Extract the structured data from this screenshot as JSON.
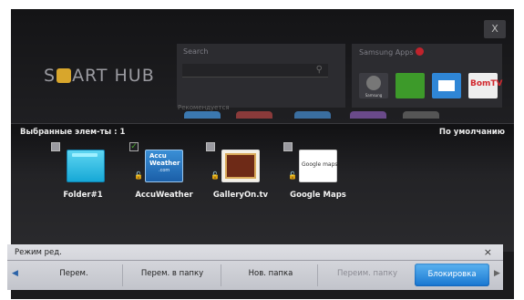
{
  "hub": {
    "logo_prefix": "S",
    "logo_suffix": "ART HUB",
    "close_label": "X",
    "search_title": "Search",
    "recommended_label": "Рекомендуется",
    "apps_title": "Samsung Apps",
    "app_label_1": "Samsung",
    "app_label_4": "BomTV"
  },
  "favorites": {
    "selected_label": "Выбранные элем-ты : 1",
    "sort_label": "По умолчанию",
    "items": [
      {
        "label": "Folder#1",
        "checked": false
      },
      {
        "label": "AccuWeather",
        "checked": true,
        "tile_text_1": "Accu",
        "tile_text_2": "Weather",
        "tile_text_3": ".com"
      },
      {
        "label": "GalleryOn.tv",
        "checked": false
      },
      {
        "label": "Google Maps",
        "checked": false,
        "tile_text": "Google maps"
      }
    ]
  },
  "edit_mode": {
    "title": "Режим ред.",
    "close": "×",
    "buttons": [
      "Перем.",
      "Перем. в папку",
      "Нов. папка",
      "Переим. папку",
      "Блокировка"
    ]
  },
  "colors": {
    "accent_blue": "#1876d1",
    "check_green": "#4aa82e",
    "folder_cyan": "#20b6e0"
  }
}
